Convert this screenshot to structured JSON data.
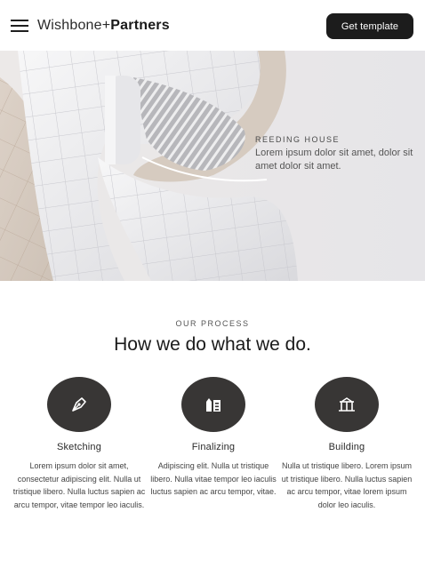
{
  "header": {
    "brand_light": "Wishbone+",
    "brand_bold": "Partners",
    "cta_label": "Get template"
  },
  "hero": {
    "kicker": "REEDING HOUSE",
    "text": "Lorem ipsum dolor sit amet, dolor sit amet dolor sit amet."
  },
  "process": {
    "kicker": "OUR PROCESS",
    "title": "How we do what we do.",
    "steps": [
      {
        "icon": "pen-nib-icon",
        "title": "Sketching",
        "text": "Lorem ipsum dolor sit amet, consectetur adipiscing elit. Nulla ut tristique libero. Nulla luctus sapien ac arcu tempor, vitae tempor leo iaculis."
      },
      {
        "icon": "buildings-icon",
        "title": "Finalizing",
        "text": "Adipiscing elit. Nulla ut tristique libero. Nulla vitae tempor leo iaculis luctus sapien ac arcu tempor, vitae."
      },
      {
        "icon": "building-columns-icon",
        "title": "Building",
        "text": "Nulla ut tristique libero. Lorem ipsum ut tristique libero. Nulla luctus sapien ac arcu tempor, vitae lorem ipsum dolor leo iaculis."
      }
    ]
  },
  "colors": {
    "accent_dark": "#1c1c1c",
    "icon_circle": "#383635",
    "hero_background": "#e9e8ea",
    "building_beige": "#d8cec4"
  }
}
